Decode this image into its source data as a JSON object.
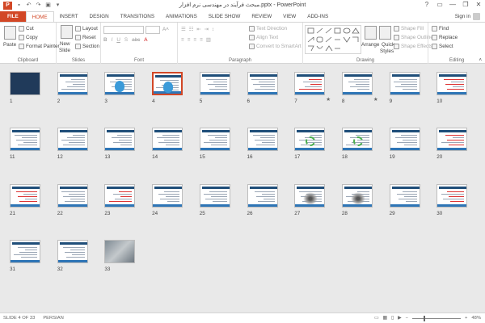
{
  "window": {
    "title": "مبحث فرآیند در مهندسی نرم افزار.pptx - PowerPoint",
    "app_logo": "P",
    "controls": [
      "?",
      "▭",
      "—",
      "❐",
      "✕"
    ]
  },
  "qat": [
    "save-icon",
    "undo-icon",
    "redo-icon",
    "start-from-beginning-icon",
    "customize-qat-icon"
  ],
  "tabs": [
    "FILE",
    "HOME",
    "INSERT",
    "DESIGN",
    "TRANSITIONS",
    "ANIMATIONS",
    "SLIDE SHOW",
    "REVIEW",
    "VIEW",
    "ADD-INS"
  ],
  "active_tab": "HOME",
  "signin": "Sign in",
  "ribbon": {
    "clipboard": {
      "label": "Clipboard",
      "paste": "Paste",
      "cut": "Cut",
      "copy": "Copy",
      "format_painter": "Format Painter"
    },
    "slides": {
      "label": "Slides",
      "new_slide": "New",
      "new_slide2": "Slide",
      "layout": "Layout",
      "reset": "Reset",
      "section": "Section"
    },
    "font": {
      "label": "Font"
    },
    "paragraph": {
      "label": "Paragraph",
      "text_direction": "Text Direction",
      "align_text": "Align Text",
      "convert_smartart": "Convert to SmartArt"
    },
    "drawing": {
      "label": "Drawing",
      "arrange": "Arrange",
      "quick_styles": "Quick",
      "quick_styles2": "Styles",
      "shape_fill": "Shape Fill",
      "shape_outline": "Shape Outline",
      "shape_effects": "Shape Effects"
    },
    "editing": {
      "label": "Editing",
      "find": "Find",
      "replace": "Replace",
      "select": "Select"
    }
  },
  "slides": [
    {
      "n": "1",
      "kind": "dark"
    },
    {
      "n": "2",
      "kind": "text"
    },
    {
      "n": "3",
      "kind": "drop"
    },
    {
      "n": "4",
      "kind": "drop",
      "selected": true
    },
    {
      "n": "5",
      "kind": "text"
    },
    {
      "n": "6",
      "kind": "text"
    },
    {
      "n": "7",
      "kind": "red",
      "star": true
    },
    {
      "n": "8",
      "kind": "text",
      "star": true
    },
    {
      "n": "9",
      "kind": "text"
    },
    {
      "n": "10",
      "kind": "red"
    },
    {
      "n": "11",
      "kind": "diag"
    },
    {
      "n": "12",
      "kind": "diag"
    },
    {
      "n": "13",
      "kind": "diag"
    },
    {
      "n": "14",
      "kind": "diag"
    },
    {
      "n": "15",
      "kind": "text"
    },
    {
      "n": "16",
      "kind": "text"
    },
    {
      "n": "17",
      "kind": "cycle"
    },
    {
      "n": "18",
      "kind": "cycle"
    },
    {
      "n": "19",
      "kind": "text"
    },
    {
      "n": "20",
      "kind": "red"
    },
    {
      "n": "21",
      "kind": "red"
    },
    {
      "n": "22",
      "kind": "text"
    },
    {
      "n": "23",
      "kind": "red"
    },
    {
      "n": "24",
      "kind": "diag"
    },
    {
      "n": "25",
      "kind": "text"
    },
    {
      "n": "26",
      "kind": "text"
    },
    {
      "n": "27",
      "kind": "spark"
    },
    {
      "n": "28",
      "kind": "spark"
    },
    {
      "n": "29",
      "kind": "text"
    },
    {
      "n": "30",
      "kind": "red"
    },
    {
      "n": "31",
      "kind": "text"
    },
    {
      "n": "32",
      "kind": "text"
    },
    {
      "n": "33",
      "kind": "photo"
    }
  ],
  "star_glyph": "★",
  "status": {
    "slide_of": "SLIDE 4 OF 33",
    "language": "PERSIAN",
    "zoom": "48%",
    "zoom_level": 0.48
  },
  "colors": {
    "accent": "#d24726",
    "slide_header": "#1f4e79",
    "slide_footer": "#2e75b6"
  }
}
